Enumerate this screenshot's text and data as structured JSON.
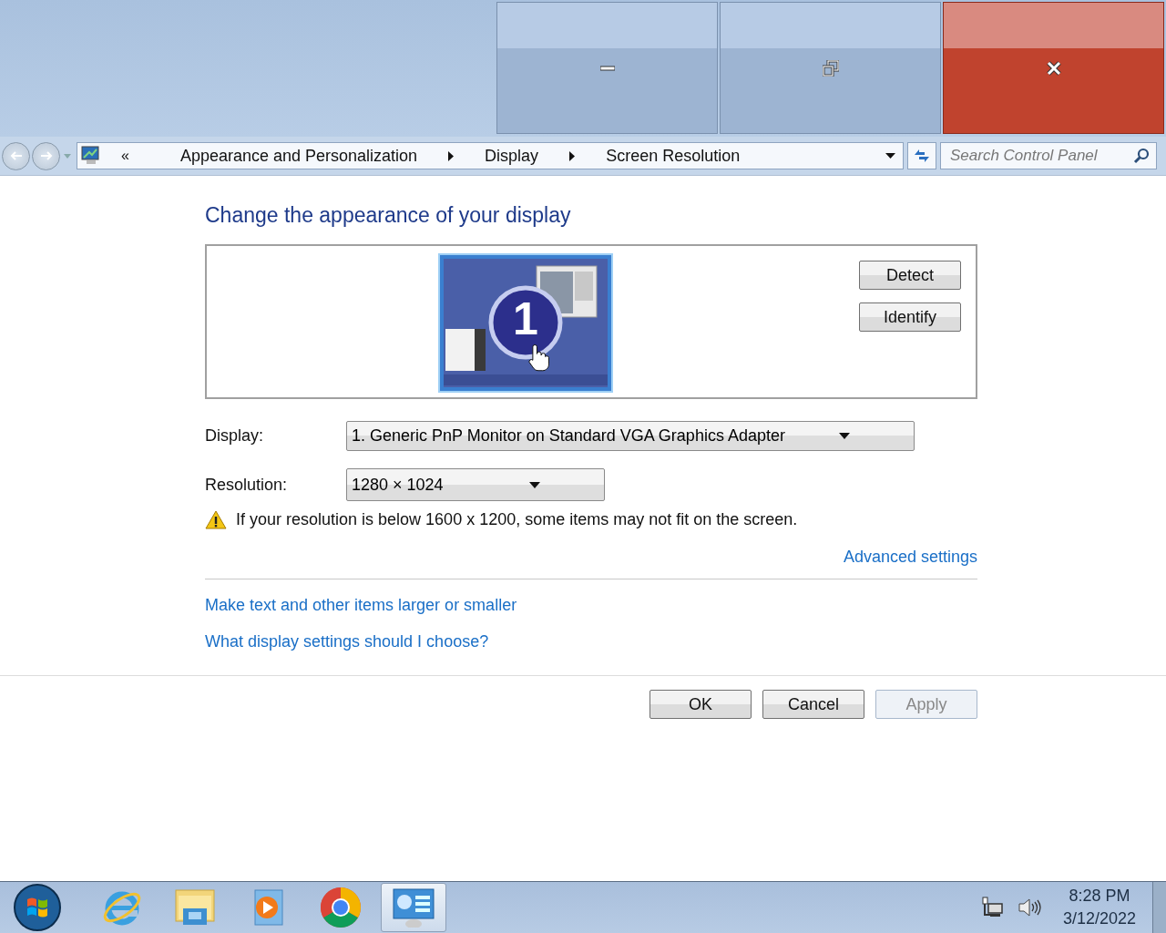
{
  "address_bar": {
    "overflow": "«",
    "crumbs": [
      "Appearance and Personalization",
      "Display",
      "Screen Resolution"
    ]
  },
  "search": {
    "placeholder": "Search Control Panel"
  },
  "heading": "Change the appearance of your display",
  "monitor_panel": {
    "monitor_number": "1",
    "buttons": [
      "Detect",
      "Identify"
    ]
  },
  "fields": [
    {
      "label": "Display:",
      "value": "1. Generic PnP Monitor on Standard VGA Graphics Adapter",
      "kind": "wide"
    },
    {
      "label": "Resolution:",
      "value": "1280 × 1024",
      "kind": "narrow"
    }
  ],
  "warning": "If your resolution is below 1600 x 1200, some items may not fit on the screen.",
  "advanced_link": "Advanced settings",
  "links": [
    "Make text and other items larger or smaller",
    "What display settings should I choose?"
  ],
  "buttons": [
    {
      "label": "OK",
      "disabled": false
    },
    {
      "label": "Cancel",
      "disabled": false
    },
    {
      "label": "Apply",
      "disabled": true
    }
  ],
  "taskbar": {
    "apps": [
      {
        "selected": false
      },
      {
        "selected": false
      },
      {
        "selected": false
      },
      {
        "selected": false
      },
      {
        "selected": true
      }
    ],
    "time": "8:28 PM",
    "date": "3/12/2022"
  }
}
